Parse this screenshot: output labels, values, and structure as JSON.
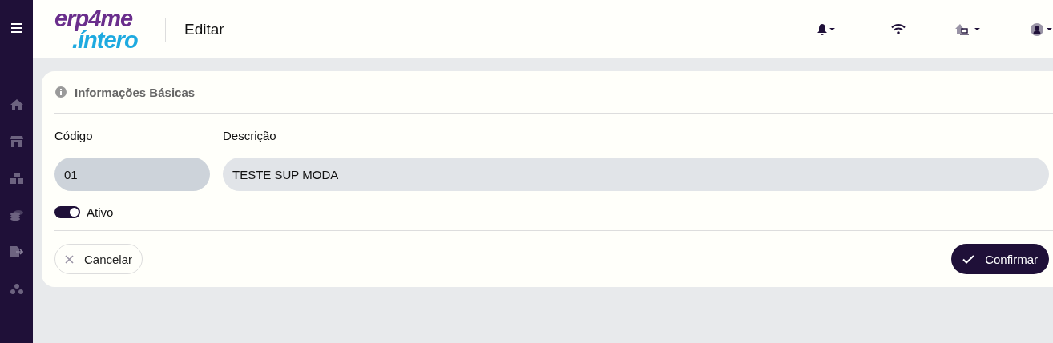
{
  "logo": {
    "line_1": "erp4me",
    "line_2": ".íntero"
  },
  "page_title": "Editar",
  "section": {
    "title": "Informações Básicas"
  },
  "fields": [
    {
      "label": "Código",
      "value": "01",
      "disabled": true
    },
    {
      "label": "Descrição",
      "value": "TESTE SUP MODA",
      "disabled": false
    }
  ],
  "toggle": {
    "label": "Ativo",
    "on": true
  },
  "buttons": [
    {
      "label": "Cancelar",
      "kind": "cancel"
    },
    {
      "label": "Confirmar",
      "kind": "confirm"
    }
  ]
}
